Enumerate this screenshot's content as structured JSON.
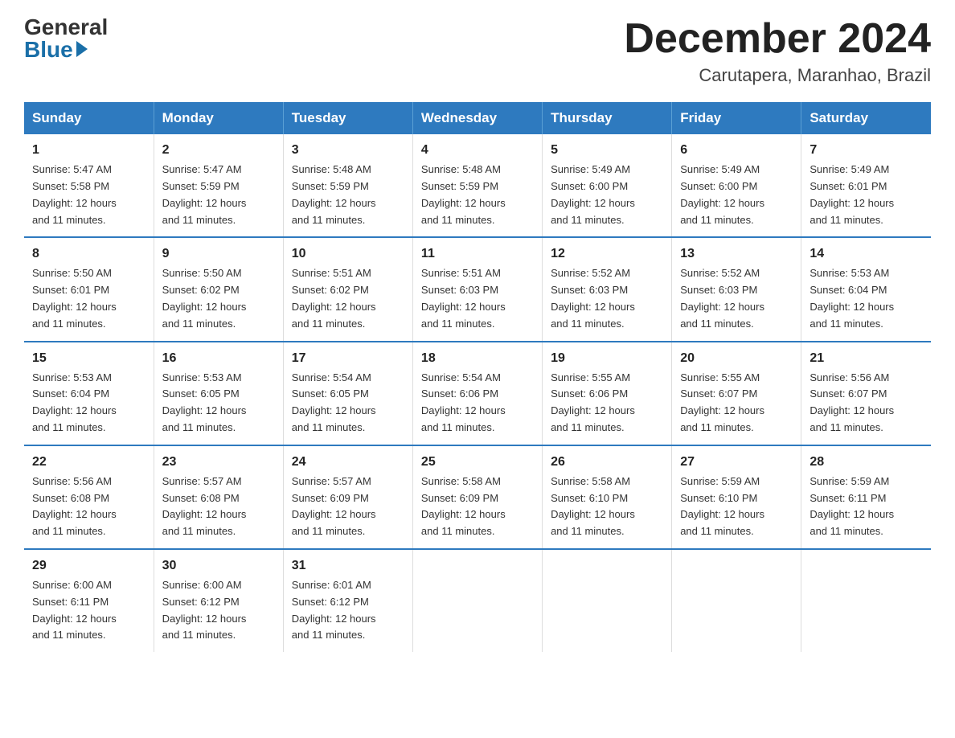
{
  "logo": {
    "general": "General",
    "blue": "Blue"
  },
  "header": {
    "month": "December 2024",
    "location": "Carutapera, Maranhao, Brazil"
  },
  "days_of_week": [
    "Sunday",
    "Monday",
    "Tuesday",
    "Wednesday",
    "Thursday",
    "Friday",
    "Saturday"
  ],
  "weeks": [
    [
      {
        "day": "1",
        "sunrise": "5:47 AM",
        "sunset": "5:58 PM",
        "daylight": "12 hours and 11 minutes."
      },
      {
        "day": "2",
        "sunrise": "5:47 AM",
        "sunset": "5:59 PM",
        "daylight": "12 hours and 11 minutes."
      },
      {
        "day": "3",
        "sunrise": "5:48 AM",
        "sunset": "5:59 PM",
        "daylight": "12 hours and 11 minutes."
      },
      {
        "day": "4",
        "sunrise": "5:48 AM",
        "sunset": "5:59 PM",
        "daylight": "12 hours and 11 minutes."
      },
      {
        "day": "5",
        "sunrise": "5:49 AM",
        "sunset": "6:00 PM",
        "daylight": "12 hours and 11 minutes."
      },
      {
        "day": "6",
        "sunrise": "5:49 AM",
        "sunset": "6:00 PM",
        "daylight": "12 hours and 11 minutes."
      },
      {
        "day": "7",
        "sunrise": "5:49 AM",
        "sunset": "6:01 PM",
        "daylight": "12 hours and 11 minutes."
      }
    ],
    [
      {
        "day": "8",
        "sunrise": "5:50 AM",
        "sunset": "6:01 PM",
        "daylight": "12 hours and 11 minutes."
      },
      {
        "day": "9",
        "sunrise": "5:50 AM",
        "sunset": "6:02 PM",
        "daylight": "12 hours and 11 minutes."
      },
      {
        "day": "10",
        "sunrise": "5:51 AM",
        "sunset": "6:02 PM",
        "daylight": "12 hours and 11 minutes."
      },
      {
        "day": "11",
        "sunrise": "5:51 AM",
        "sunset": "6:03 PM",
        "daylight": "12 hours and 11 minutes."
      },
      {
        "day": "12",
        "sunrise": "5:52 AM",
        "sunset": "6:03 PM",
        "daylight": "12 hours and 11 minutes."
      },
      {
        "day": "13",
        "sunrise": "5:52 AM",
        "sunset": "6:03 PM",
        "daylight": "12 hours and 11 minutes."
      },
      {
        "day": "14",
        "sunrise": "5:53 AM",
        "sunset": "6:04 PM",
        "daylight": "12 hours and 11 minutes."
      }
    ],
    [
      {
        "day": "15",
        "sunrise": "5:53 AM",
        "sunset": "6:04 PM",
        "daylight": "12 hours and 11 minutes."
      },
      {
        "day": "16",
        "sunrise": "5:53 AM",
        "sunset": "6:05 PM",
        "daylight": "12 hours and 11 minutes."
      },
      {
        "day": "17",
        "sunrise": "5:54 AM",
        "sunset": "6:05 PM",
        "daylight": "12 hours and 11 minutes."
      },
      {
        "day": "18",
        "sunrise": "5:54 AM",
        "sunset": "6:06 PM",
        "daylight": "12 hours and 11 minutes."
      },
      {
        "day": "19",
        "sunrise": "5:55 AM",
        "sunset": "6:06 PM",
        "daylight": "12 hours and 11 minutes."
      },
      {
        "day": "20",
        "sunrise": "5:55 AM",
        "sunset": "6:07 PM",
        "daylight": "12 hours and 11 minutes."
      },
      {
        "day": "21",
        "sunrise": "5:56 AM",
        "sunset": "6:07 PM",
        "daylight": "12 hours and 11 minutes."
      }
    ],
    [
      {
        "day": "22",
        "sunrise": "5:56 AM",
        "sunset": "6:08 PM",
        "daylight": "12 hours and 11 minutes."
      },
      {
        "day": "23",
        "sunrise": "5:57 AM",
        "sunset": "6:08 PM",
        "daylight": "12 hours and 11 minutes."
      },
      {
        "day": "24",
        "sunrise": "5:57 AM",
        "sunset": "6:09 PM",
        "daylight": "12 hours and 11 minutes."
      },
      {
        "day": "25",
        "sunrise": "5:58 AM",
        "sunset": "6:09 PM",
        "daylight": "12 hours and 11 minutes."
      },
      {
        "day": "26",
        "sunrise": "5:58 AM",
        "sunset": "6:10 PM",
        "daylight": "12 hours and 11 minutes."
      },
      {
        "day": "27",
        "sunrise": "5:59 AM",
        "sunset": "6:10 PM",
        "daylight": "12 hours and 11 minutes."
      },
      {
        "day": "28",
        "sunrise": "5:59 AM",
        "sunset": "6:11 PM",
        "daylight": "12 hours and 11 minutes."
      }
    ],
    [
      {
        "day": "29",
        "sunrise": "6:00 AM",
        "sunset": "6:11 PM",
        "daylight": "12 hours and 11 minutes."
      },
      {
        "day": "30",
        "sunrise": "6:00 AM",
        "sunset": "6:12 PM",
        "daylight": "12 hours and 11 minutes."
      },
      {
        "day": "31",
        "sunrise": "6:01 AM",
        "sunset": "6:12 PM",
        "daylight": "12 hours and 11 minutes."
      },
      null,
      null,
      null,
      null
    ]
  ],
  "labels": {
    "sunrise": "Sunrise:",
    "sunset": "Sunset:",
    "daylight": "Daylight:"
  }
}
